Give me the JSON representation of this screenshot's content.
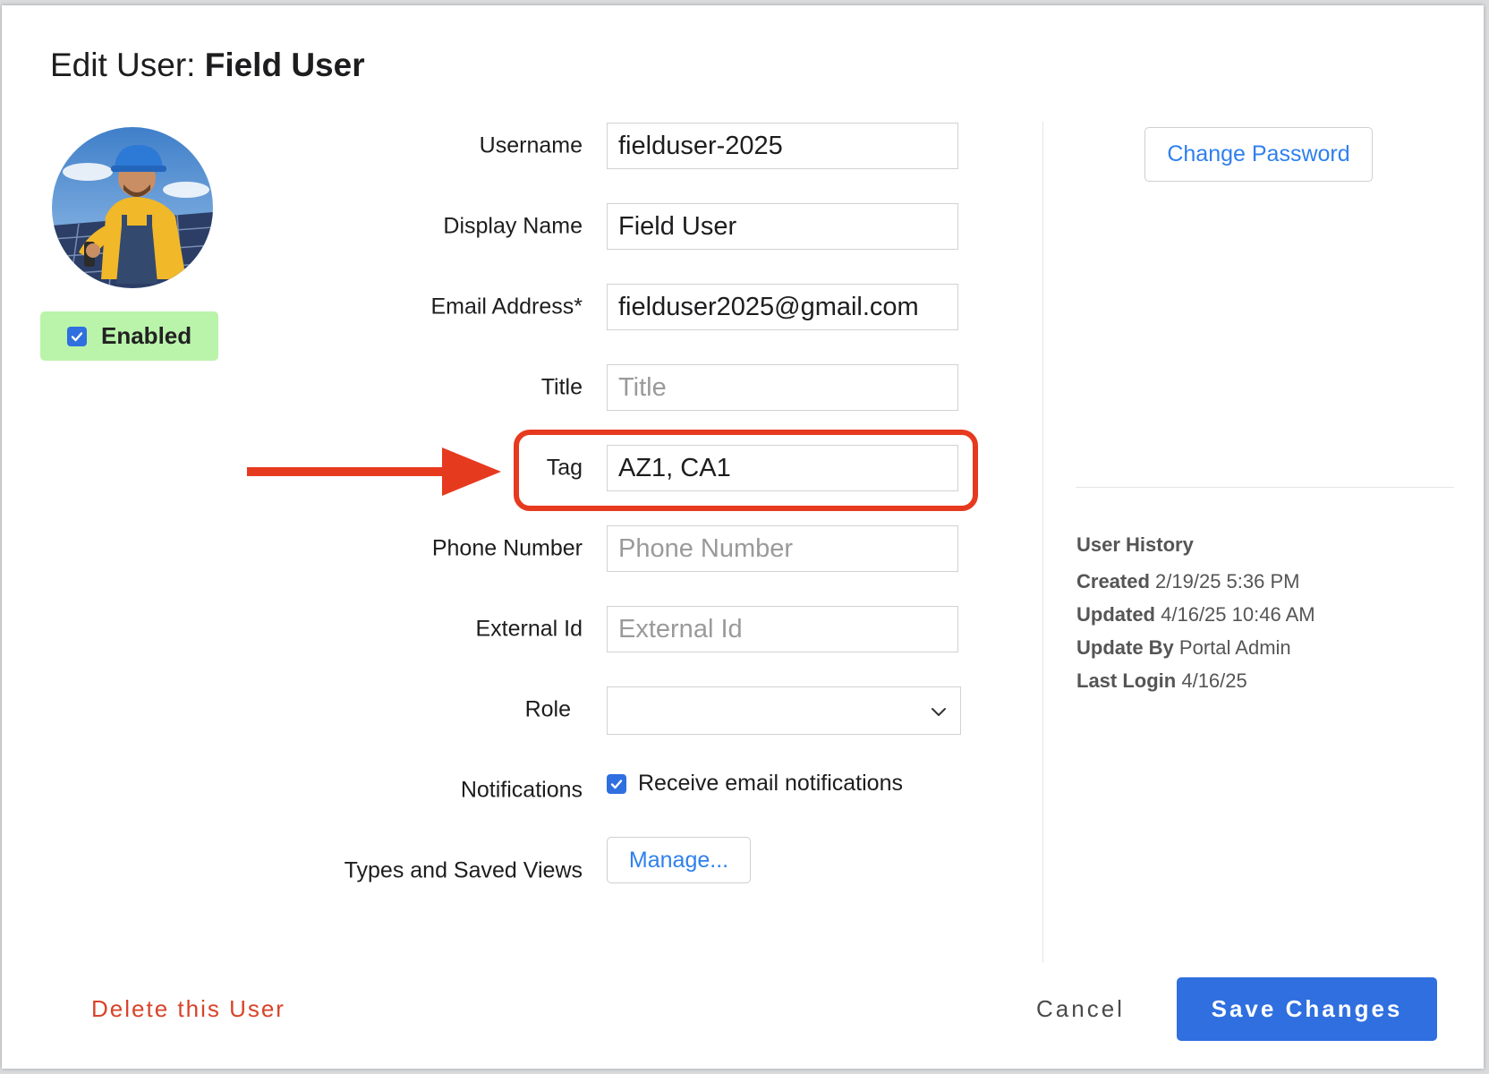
{
  "dialog": {
    "title_prefix": "Edit User:",
    "title_name": "Field User"
  },
  "profile": {
    "avatar_description": "avatar",
    "enabled_label": "Enabled",
    "enabled_checked": true
  },
  "form": {
    "username": {
      "label": "Username",
      "value": "fielduser-2025",
      "placeholder": ""
    },
    "display_name": {
      "label": "Display Name",
      "value": "Field User",
      "placeholder": ""
    },
    "email": {
      "label": "Email Address*",
      "value": "fielduser2025@gmail.com",
      "placeholder": ""
    },
    "title": {
      "label": "Title",
      "value": "",
      "placeholder": "Title"
    },
    "tag": {
      "label": "Tag",
      "value": "AZ1, CA1",
      "placeholder": ""
    },
    "phone": {
      "label": "Phone Number",
      "value": "",
      "placeholder": "Phone Number"
    },
    "external_id": {
      "label": "External Id",
      "value": "",
      "placeholder": "External Id"
    },
    "role": {
      "label": "Role",
      "value": ""
    },
    "notifications": {
      "label": "Notifications",
      "checkbox_label": "Receive email notifications",
      "checked": true
    },
    "types_views": {
      "label": "Types and Saved Views",
      "button_label": "Manage..."
    }
  },
  "side": {
    "change_password_label": "Change Password",
    "history_title": "User History",
    "history": [
      {
        "key": "Created",
        "value": "2/19/25 5:36 PM"
      },
      {
        "key": "Updated",
        "value": "4/16/25 10:46 AM"
      },
      {
        "key": "Update By",
        "value": "Portal Admin"
      },
      {
        "key": "Last Login",
        "value": "4/16/25"
      }
    ]
  },
  "footer": {
    "delete_label": "Delete this User",
    "cancel_label": "Cancel",
    "save_label": "Save Changes"
  },
  "colors": {
    "accent": "#2f6fdf",
    "link": "#2f80ed",
    "danger": "#d8432a",
    "enabled_bg": "#b9f4aa",
    "annotation": "#e63a1f"
  },
  "icons": {
    "checkbox": "checkmark-icon",
    "select": "chevron-down-icon",
    "annotation": "arrow-right-icon"
  }
}
